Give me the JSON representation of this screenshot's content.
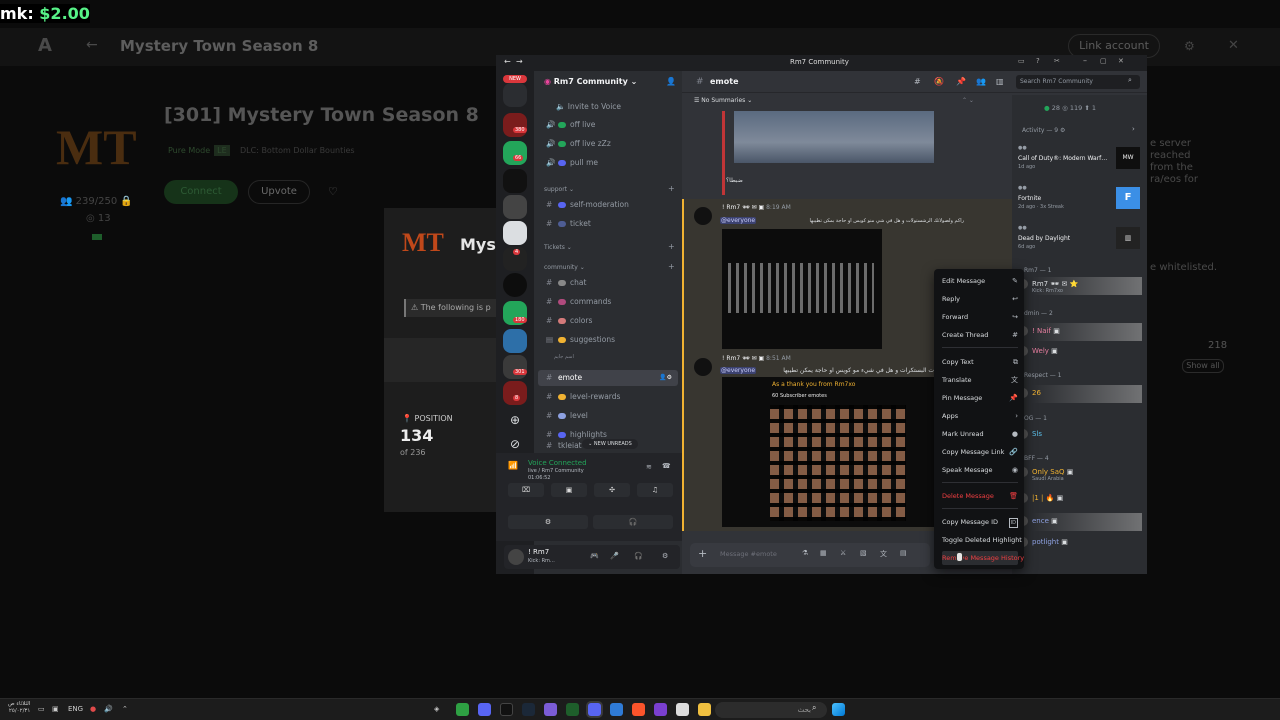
{
  "overlay": {
    "label": "mk:",
    "amount": "$2.00"
  },
  "bg": {
    "back": "←",
    "logo": "A",
    "title": "Mystery Town Season 8",
    "link_account": "Link account",
    "server": {
      "logo": "MT",
      "name": "[301] Mystery Town Season 8",
      "mode": "Pure Mode",
      "mode_badge": "LE",
      "dlc": "DLC: Bottom Dollar Bounties",
      "players": "239/250",
      "rank": "13",
      "connect": "Connect",
      "upvote": "Upvote"
    },
    "panel": {
      "logo": "MT",
      "name": "Mys",
      "warning": "The following is p",
      "position_label": "POSITION",
      "position_value": "134",
      "position_of": "of 236"
    },
    "right": {
      "text_lines": [
        "e server",
        "reached",
        "from the",
        "ra/eos for"
      ],
      "whitelisted": "e whitelisted.",
      "count": "218",
      "show_all": "Show all"
    }
  },
  "discord": {
    "title": "Rm7 Community",
    "nav_back": "←",
    "nav_forward": "→",
    "new_badge": "NEW",
    "servers": [
      {
        "badge": ""
      },
      {
        "badge": "380"
      },
      {
        "badge": "66"
      },
      {
        "badge": ""
      },
      {
        "badge": ""
      },
      {
        "badge": ""
      },
      {
        "badge": "4"
      },
      {
        "badge": ""
      },
      {
        "badge": "180"
      },
      {
        "badge": ""
      },
      {
        "badge": "301"
      },
      {
        "badge": "8"
      }
    ],
    "server_name": "Rm7 Community",
    "invite": "Invite to Voice",
    "channels_top": [
      {
        "name": "off live",
        "color": "#23a55a"
      },
      {
        "name": "off live zZz",
        "color": "#23a55a"
      },
      {
        "name": "pull me",
        "color": "#5865f2"
      }
    ],
    "cat_support": "support",
    "channels_support": [
      {
        "name": "self-moderation"
      },
      {
        "name": "ticket"
      }
    ],
    "cat_tickets": "Tickets",
    "cat_community": "community",
    "channels_community": [
      {
        "name": "chat"
      },
      {
        "name": "commands"
      },
      {
        "name": "colors"
      },
      {
        "name": "suggestions"
      }
    ],
    "thread_hint": "اسم جايم",
    "active_channel": "emote",
    "channels_after": [
      {
        "name": "level-rewards"
      },
      {
        "name": "level"
      },
      {
        "name": "highlights"
      },
      {
        "name": "tkleiat"
      }
    ],
    "new_unreads": "NEW UNREADS",
    "voice": {
      "status": "Voice Connected",
      "detail": "live / Rm7 Community",
      "time": "01:06:52"
    },
    "user": {
      "name": "! Rm7",
      "status": "Kick: Rm…"
    },
    "chat_header": "emote",
    "summaries": "No Summaries",
    "search_placeholder": "Search Rm7 Community",
    "caption_1": "ضبطا؟",
    "msg1": {
      "author": "! Rm7",
      "time": "8:19 AM",
      "mention": "@everyone",
      "text": "راكم ولصولاتك الرشستولات و هل في شي منو كويس او حاجة بمكن تطيبها"
    },
    "msg2": {
      "author": "! Rm7",
      "time": "8:51 AM",
      "mention": "@everyone",
      "text": "ت البستكرات و هل في شيء مو كويس او حاجة يمكن تطيبها",
      "img_title": "As a thank you from Rm7xo",
      "img_sub": "60 Subscriber emotes"
    },
    "composer_placeholder": "Message #emote",
    "members_stats": {
      "online": "28",
      "total": "119",
      "other": "1"
    },
    "activity": {
      "header": "Activity — 9",
      "items": [
        {
          "game": "Call of Duty®: Modern Warf…",
          "sub": "1d ago"
        },
        {
          "game": "Fortnite",
          "sub": "2d ago  ·  3x Streak"
        },
        {
          "game": "Dead by Daylight",
          "sub": "6d ago"
        }
      ]
    },
    "member_groups": [
      {
        "header": "Rm7 — 1"
      },
      {
        "header": "dmin — 2"
      },
      {
        "header": "Respect — 1"
      },
      {
        "header": "OG — 1"
      },
      {
        "header": "BFF — 4"
      }
    ],
    "members": [
      {
        "name": "Rm7",
        "sub": "Kick: Rm7xo"
      },
      {
        "name": "! Naif",
        "sub": ""
      },
      {
        "name": "Wely",
        "sub": ""
      },
      {
        "name": "26",
        "sub": ""
      },
      {
        "name": "Sls",
        "sub": ""
      },
      {
        "name": "Only SaQ",
        "sub": "Saudi Arabia"
      },
      {
        "name": "|1 |",
        "sub": ""
      },
      {
        "name": "ence",
        "sub": ""
      },
      {
        "name": "potlight",
        "sub": ""
      }
    ],
    "context_menu": [
      {
        "label": "Edit Message",
        "icon": "✎",
        "red": false
      },
      {
        "label": "Reply",
        "icon": "↩",
        "red": false
      },
      {
        "label": "Forward",
        "icon": "↪",
        "red": false
      },
      {
        "label": "Create Thread",
        "icon": "#",
        "red": false
      },
      {
        "label": "Copy Text",
        "icon": "⧉",
        "red": false
      },
      {
        "label": "Translate",
        "icon": "文",
        "red": false
      },
      {
        "label": "Pin Message",
        "icon": "📌",
        "red": false
      },
      {
        "label": "Apps",
        "icon": "›",
        "red": false
      },
      {
        "label": "Mark Unread",
        "icon": "●",
        "red": false
      },
      {
        "label": "Copy Message Link",
        "icon": "🔗",
        "red": false
      },
      {
        "label": "Speak Message",
        "icon": "◉",
        "red": false
      },
      {
        "label": "Delete Message",
        "icon": "🗑",
        "red": true
      },
      {
        "label": "Copy Message ID",
        "icon": "ID",
        "red": false
      },
      {
        "label": "Toggle Deleted Highlight",
        "icon": "",
        "red": false
      },
      {
        "label": "Remove Message History",
        "icon": "",
        "red": true
      }
    ]
  },
  "taskbar": {
    "date_line1": "الثلاثاء ص",
    "date_line2": "٢٥/٠٢/٣١",
    "lang": "ENG",
    "search": "بحث"
  }
}
